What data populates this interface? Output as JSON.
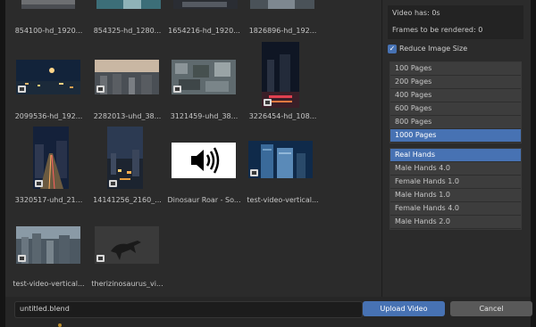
{
  "files": [
    {
      "name": "854100-hd_1920...",
      "kind": "video"
    },
    {
      "name": "854325-hd_1280...",
      "kind": "video"
    },
    {
      "name": "1654216-hd_1920...",
      "kind": "video"
    },
    {
      "name": "1826896-hd_192...",
      "kind": "video"
    },
    {
      "name": "2099536-hd_192...",
      "kind": "video"
    },
    {
      "name": "2282013-uhd_38...",
      "kind": "video"
    },
    {
      "name": "3121459-uhd_38...",
      "kind": "video"
    },
    {
      "name": "3226454-hd_108...",
      "kind": "video"
    },
    {
      "name": "3320517-uhd_21...",
      "kind": "video"
    },
    {
      "name": "14141256_2160_...",
      "kind": "video"
    },
    {
      "name": "Dinosaur Roar - So...",
      "kind": "audio"
    },
    {
      "name": "test-video-vertical...",
      "kind": "video"
    },
    {
      "name": "test-video-vertical...",
      "kind": "video"
    },
    {
      "name": "therizinosaurus_vi...",
      "kind": "video"
    }
  ],
  "info": {
    "video_has": "Video has: 0s",
    "frames": "Frames to be rendered: 0"
  },
  "reduce_image_size": {
    "label": "Reduce Image Size",
    "checked": true
  },
  "pages": {
    "options": [
      "100 Pages",
      "200 Pages",
      "400 Pages",
      "600 Pages",
      "800 Pages",
      "1000 Pages"
    ],
    "selected": "1000 Pages"
  },
  "hands": {
    "options": [
      "Real Hands",
      "Male Hands 4.0",
      "Female Hands 1.0",
      "Male Hands 1.0",
      "Female Hands 4.0",
      "Male Hands 2.0"
    ],
    "selected": "Real Hands"
  },
  "filename": "untitled.blend",
  "buttons": {
    "upload": "Upload Video",
    "cancel": "Cancel"
  },
  "colors": {
    "accent": "#4772b3",
    "panel": "#2b2b2b",
    "background": "#1d1d1d"
  }
}
